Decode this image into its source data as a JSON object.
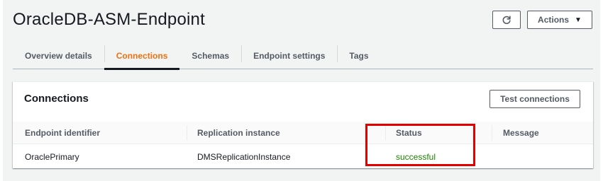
{
  "header": {
    "title": "OracleDB-ASM-Endpoint",
    "actions_label": "Actions"
  },
  "tabs": [
    {
      "label": "Overview details",
      "active": false
    },
    {
      "label": "Connections",
      "active": true
    },
    {
      "label": "Schemas",
      "active": false
    },
    {
      "label": "Endpoint settings",
      "active": false
    },
    {
      "label": "Tags",
      "active": false
    }
  ],
  "connections": {
    "title": "Connections",
    "test_button_label": "Test connections",
    "columns": [
      "Endpoint identifier",
      "Replication instance",
      "Status",
      "Message"
    ],
    "rows": [
      {
        "endpoint": "OraclePrimary",
        "instance": "DMSReplicationInstance",
        "status": "successful",
        "message": ""
      }
    ]
  },
  "colors": {
    "accent_tab": "#ec7211",
    "status_success": "#1d8102",
    "highlight_box": "#e50000"
  },
  "icons": {
    "refresh": "refresh-icon",
    "actions_caret": "caret-down-icon"
  }
}
